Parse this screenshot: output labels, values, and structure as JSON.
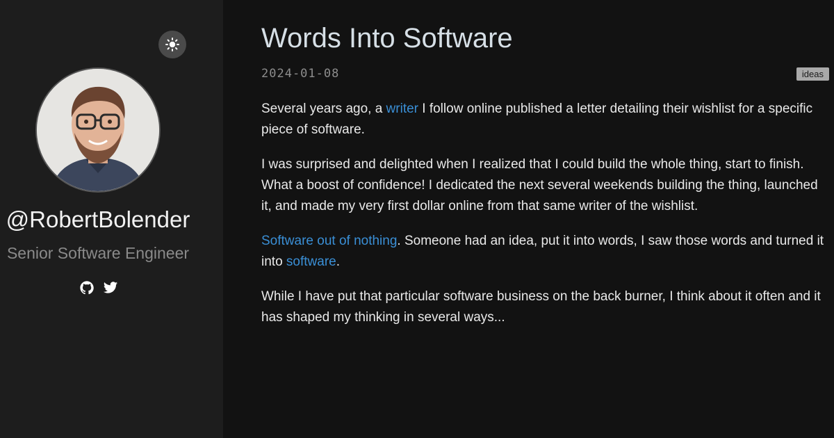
{
  "sidebar": {
    "theme_toggle_icon": "sun-icon",
    "handle": "@RobertBolender",
    "role": "Senior Software Engineer",
    "socials": [
      {
        "icon": "github-icon"
      },
      {
        "icon": "twitter-icon"
      }
    ]
  },
  "post": {
    "title": "Words Into Software",
    "date": "2024-01-08",
    "tag": "ideas",
    "p1": {
      "before": "Several years ago, a ",
      "link": "writer",
      "after": " I follow online published a letter detailing their wishlist for a specific piece of software."
    },
    "p2": "I was surprised and delighted when I realized that I could build the whole thing, start to finish. What a boost of confidence! I dedicated the next several weekends building the thing, launched it, and made my very first dollar online from that same writer of the wishlist.",
    "p3": {
      "link1": "Software out of nothing",
      "middle": ". Someone had an idea, put it into words, I saw those words and turned it into ",
      "link2": "software",
      "end": "."
    },
    "p4": "While I have put that particular software business on the back burner, I think about it often and it has shaped my thinking in several ways..."
  },
  "colors": {
    "sidebar_bg": "#1d1d1d",
    "main_bg": "#121212",
    "link": "#3a8fd6",
    "title": "#d6dfe6"
  }
}
